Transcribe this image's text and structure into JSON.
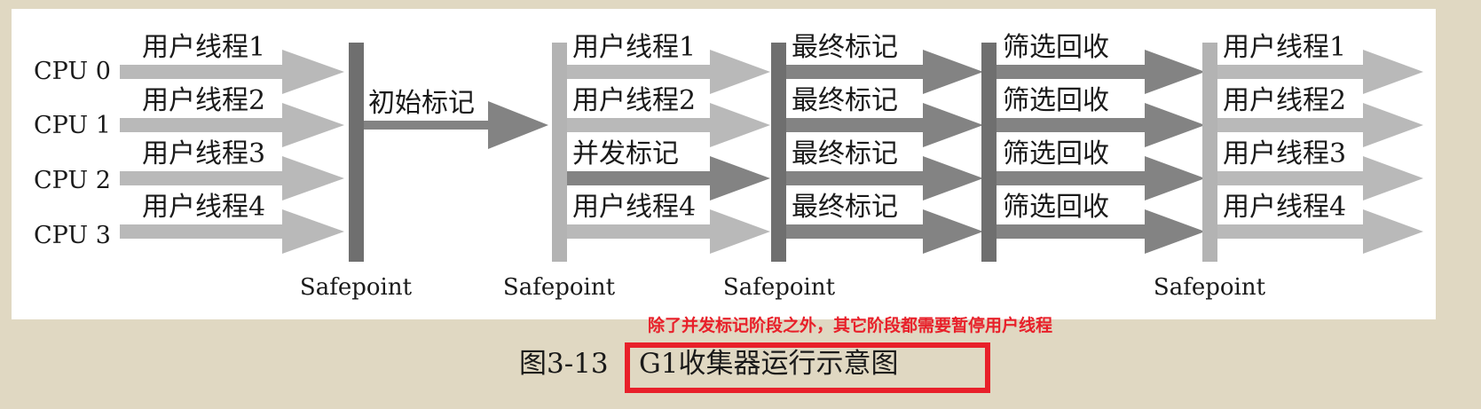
{
  "cpus": [
    "CPU 0",
    "CPU 1",
    "CPU 2",
    "CPU 3"
  ],
  "phase1": {
    "labels": [
      "用户线程1",
      "用户线程2",
      "用户线程3",
      "用户线程4"
    ]
  },
  "phase2": {
    "label": "初始标记"
  },
  "phase3": {
    "labels": [
      "用户线程1",
      "用户线程2",
      "并发标记",
      "用户线程4"
    ]
  },
  "phase4": {
    "labels": [
      "最终标记",
      "最终标记",
      "最终标记",
      "最终标记"
    ]
  },
  "phase5": {
    "labels": [
      "筛选回收",
      "筛选回收",
      "筛选回收",
      "筛选回收"
    ]
  },
  "phase6": {
    "labels": [
      "用户线程1",
      "用户线程2",
      "用户线程3",
      "用户线程4"
    ]
  },
  "safepoints": [
    "Safepoint",
    "Safepoint",
    "Safepoint",
    "Safepoint"
  ],
  "annotation": "除了并发标记阶段之外，其它阶段都需要暂停用户线程",
  "caption": {
    "figure_no": "图3-13",
    "title": "G1收集器运行示意图"
  },
  "colors": {
    "background": "#e0d8c2",
    "panel": "#ffffff",
    "arrow_light": "#b9b9b9",
    "arrow_dark": "#838383",
    "bar_dark": "#6f6f6f",
    "bar_light": "#b3b3b3",
    "highlight": "#e8202a"
  }
}
